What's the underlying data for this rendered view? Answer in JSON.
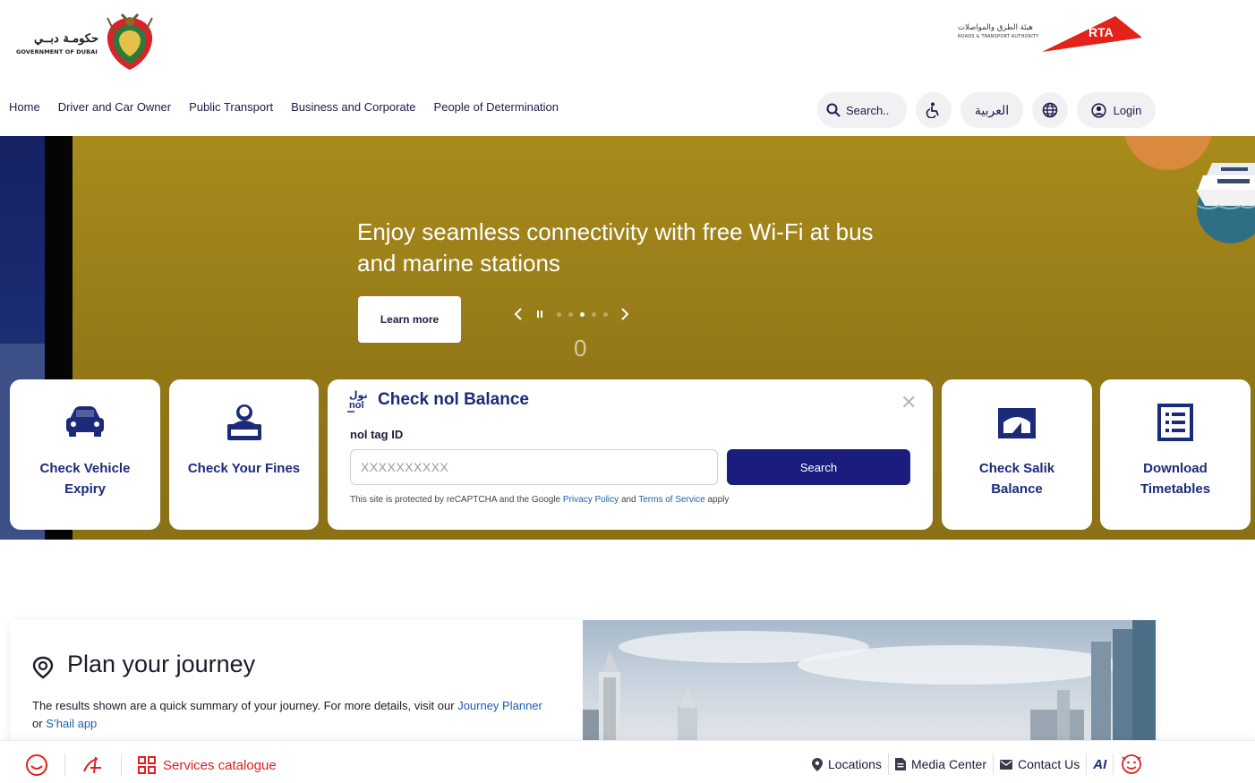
{
  "header": {
    "gov_logo": {
      "arabic": "حكومـة دبــي",
      "english": "GOVERNMENT OF DUBAI"
    },
    "rta_logo": {
      "arabic": "هيئة الطرق والمواصلات",
      "english": "ROADS & TRANSPORT AUTHORITY",
      "mark": "RTA"
    }
  },
  "nav": {
    "links": [
      "Home",
      "Driver and Car Owner",
      "Public Transport",
      "Business and Corporate",
      "People of Determination"
    ],
    "search_placeholder": "Search..",
    "language_label": "العربية",
    "login_label": "Login"
  },
  "hero": {
    "title": "Enjoy seamless connectivity with free Wi-Fi at bus and marine stations",
    "cta_label": "Learn more",
    "slides_total": 5,
    "active_slide": 3,
    "counter": "0"
  },
  "services": {
    "left_cards": [
      {
        "label": "Check Vehicle Expiry",
        "icon": "car-icon"
      },
      {
        "label": "Check Your Fines",
        "icon": "fines-person-icon"
      }
    ],
    "nol": {
      "logo_text": "نول nol",
      "title": "Check nol Balance",
      "field_label": "nol tag ID",
      "field_placeholder": "XXXXXXXXXX",
      "button_label": "Search",
      "recaptcha_prefix": "This site is protected by reCAPTCHA and the Google",
      "privacy_label": "Privacy Policy",
      "and_label": "and",
      "terms_label": "Terms of Service",
      "recaptcha_suffix": "apply"
    },
    "right_cards": [
      {
        "label": "Check Salik Balance",
        "icon": "salik-gate-icon"
      },
      {
        "label": "Download Timetables",
        "icon": "timetable-icon"
      }
    ]
  },
  "journey": {
    "title": "Plan your journey",
    "text_prefix": "The results shown are a quick summary of your journey. For more details, visit our",
    "journey_planner_link": "Journey Planner",
    "or_label": "or",
    "shail_link": "S’hail app"
  },
  "bottom_bar": {
    "services_label": "Services catalogue",
    "items": [
      "Locations",
      "Media Center",
      "Contact Us"
    ],
    "ai_label": "AI"
  },
  "colors": {
    "brand_navy": "#1c2a7a",
    "button_navy": "#1b1d7e",
    "accent_red": "#e02020",
    "hero_gold": "#a88b1b"
  }
}
